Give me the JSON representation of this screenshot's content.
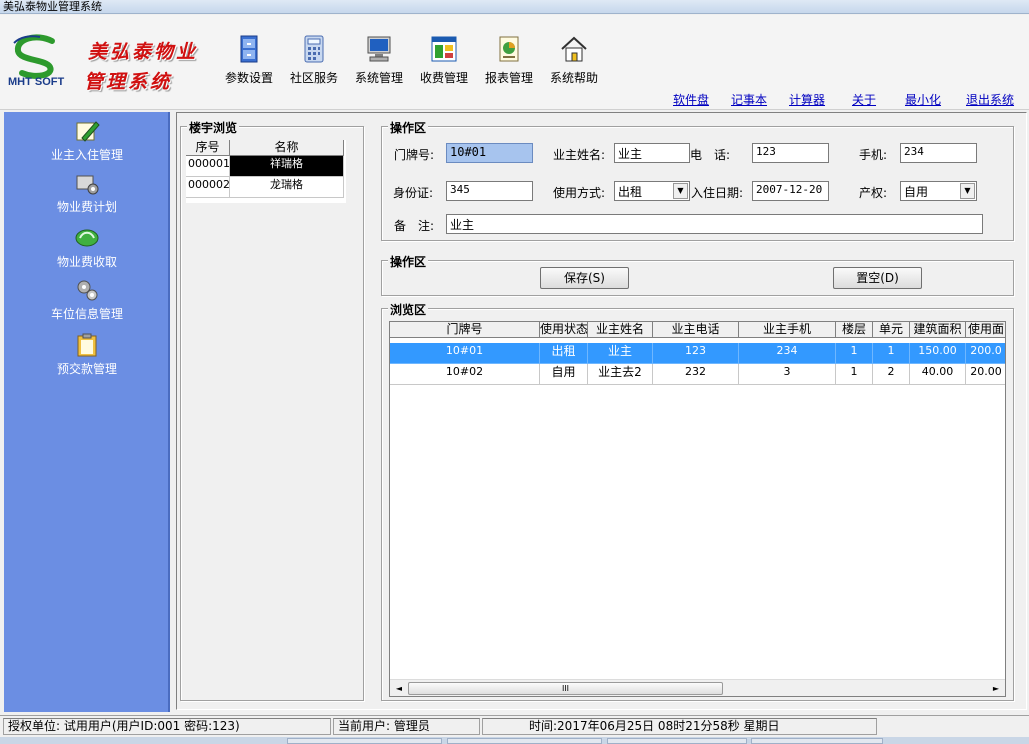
{
  "window": {
    "title": "美弘泰物业管理系统"
  },
  "brand": {
    "logo_text": "MHT SOFT",
    "line1": "美弘泰物业",
    "line2": "管理系统"
  },
  "toolbar": [
    {
      "label": "参数设置",
      "icon": "cabinet-icon"
    },
    {
      "label": "社区服务",
      "icon": "calculator-icon"
    },
    {
      "label": "系统管理",
      "icon": "computer-icon"
    },
    {
      "label": "收费管理",
      "icon": "window-icon"
    },
    {
      "label": "报表管理",
      "icon": "report-icon"
    },
    {
      "label": "系统帮助",
      "icon": "home-icon"
    }
  ],
  "links": [
    "软件盘",
    "记事本",
    "计算器",
    "关于",
    "最小化",
    "退出系统"
  ],
  "sidebar": [
    {
      "label": "业主入住管理",
      "icon": "pen-icon"
    },
    {
      "label": "物业费计划",
      "icon": "gear-printer-icon"
    },
    {
      "label": "物业费收取",
      "icon": "money-icon"
    },
    {
      "label": "车位信息管理",
      "icon": "gears-icon"
    },
    {
      "label": "预交款管理",
      "icon": "clipboard-icon"
    }
  ],
  "building": {
    "title": "楼宇浏览",
    "headers": [
      "序号",
      "名称"
    ],
    "rows": [
      [
        "000001",
        "祥瑞格"
      ],
      [
        "000002",
        "龙瑞格"
      ]
    ]
  },
  "form": {
    "title": "操作区",
    "door_label": "门牌号:",
    "door_value": "10#01",
    "owner_label": "业主姓名:",
    "owner_value": "业主",
    "phone_label": "电　话:",
    "phone_value": "123",
    "mobile_label": "手机:",
    "mobile_value": "234",
    "id_label": "身份证:",
    "id_value": "345",
    "use_label": "使用方式:",
    "use_value": "出租",
    "date_label": "入住日期:",
    "date_value": "2007-12-20",
    "prop_label": "产权:",
    "prop_value": "自用",
    "note_label": "备　注:",
    "note_value": "业主"
  },
  "actions": {
    "title": "操作区",
    "save": "保存(S)",
    "clear": "置空(D)"
  },
  "browse": {
    "title": "浏览区",
    "headers": [
      "门牌号",
      "使用状态",
      "业主姓名",
      "业主电话",
      "业主手机",
      "楼层",
      "单元",
      "建筑面积",
      "使用面"
    ],
    "rows": [
      [
        "10#01",
        "出租",
        "业主",
        "123",
        "234",
        "1",
        "1",
        "150.00",
        "200.0"
      ],
      [
        "10#02",
        "自用",
        "业主去2",
        "232",
        "3",
        "1",
        "2",
        "40.00",
        "20.00"
      ]
    ],
    "scroll_thumb": "III"
  },
  "status": {
    "auth": "授权单位: 试用用户(用户ID:001 密码:123)",
    "user": "当前用户: 管理员",
    "time": "时间:2017年06月25日 08时21分58秒 星期日"
  },
  "colors": {
    "sidebar": "#6b8ee3",
    "selection": "#3399ff",
    "brand_red": "#d01010",
    "link": "#0000c0"
  }
}
